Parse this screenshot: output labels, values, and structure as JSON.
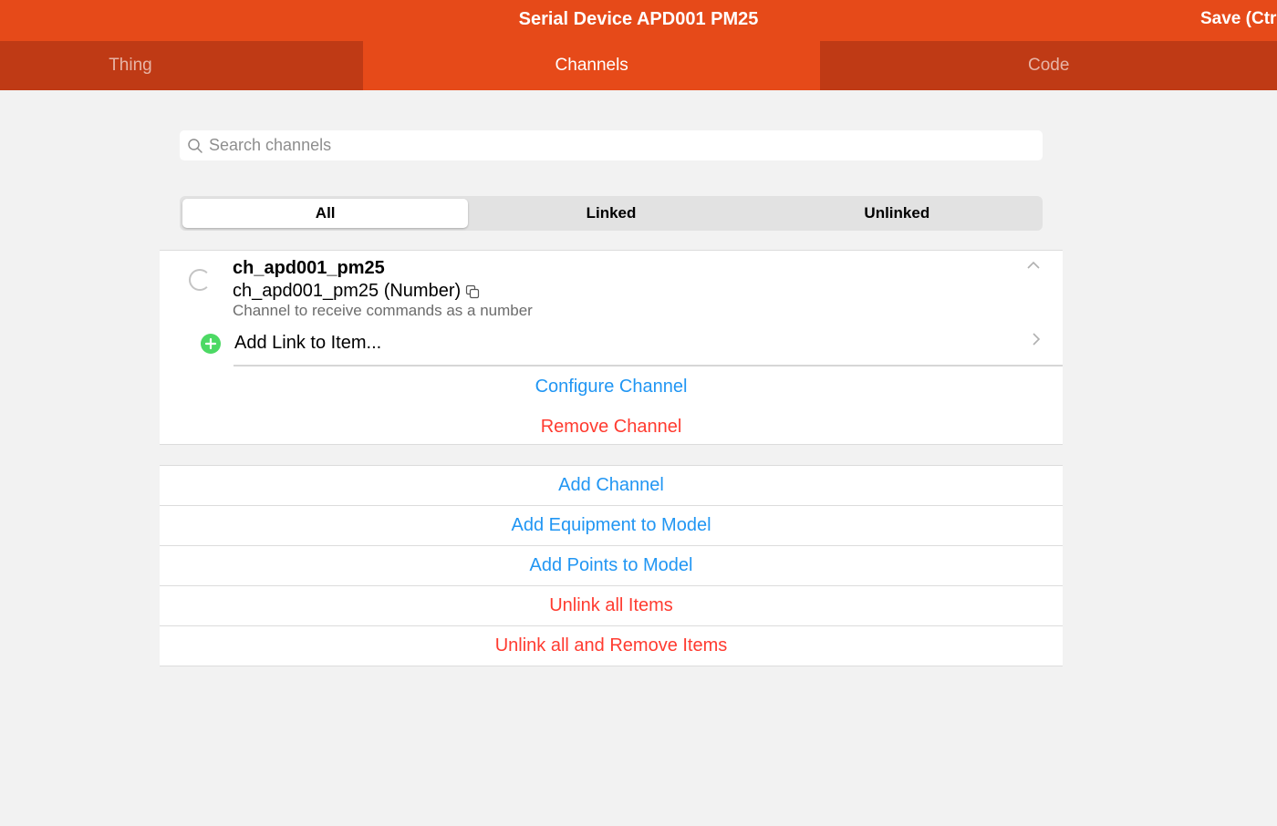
{
  "navbar": {
    "title": "Serial Device APD001 PM25",
    "save_label": "Save (Ctrl-S)"
  },
  "tabs": [
    {
      "label": "Thing",
      "active": false
    },
    {
      "label": "Channels",
      "active": true
    },
    {
      "label": "Code",
      "active": false
    }
  ],
  "search": {
    "placeholder": "Search channels",
    "value": ""
  },
  "filter": {
    "options": [
      "All",
      "Linked",
      "Unlinked"
    ],
    "selected": "All"
  },
  "channel": {
    "name": "ch_apd001_pm25",
    "id_type": "ch_apd001_pm25 (Number)",
    "description": "Channel to receive commands as a number",
    "add_link_label": "Add Link to Item...",
    "configure_label": "Configure Channel",
    "remove_label": "Remove Channel"
  },
  "actions": [
    {
      "label": "Add Channel",
      "color": "blue"
    },
    {
      "label": "Add Equipment to Model",
      "color": "blue"
    },
    {
      "label": "Add Points to Model",
      "color": "blue"
    },
    {
      "label": "Unlink all Items",
      "color": "red"
    },
    {
      "label": "Unlink all and Remove Items",
      "color": "red"
    }
  ],
  "colors": {
    "accent": "#e64a19",
    "tabbar": "#bf3a15",
    "link_blue": "#2196f3",
    "danger_red": "#ff3b30",
    "add_green": "#4cd964"
  },
  "icons": [
    "search-icon",
    "spinner-icon",
    "copy-icon",
    "chevron-up-icon",
    "plus-circle-icon",
    "chevron-right-icon"
  ]
}
